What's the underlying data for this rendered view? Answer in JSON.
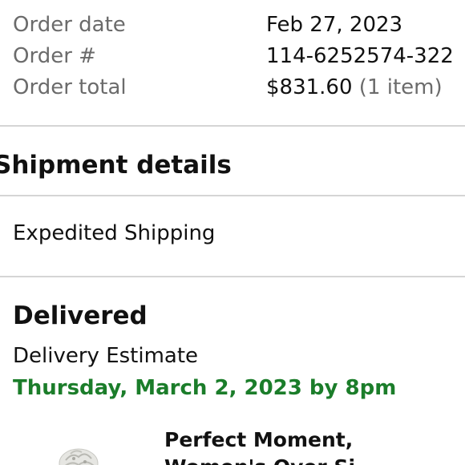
{
  "order_summary": {
    "date_label": "Order date",
    "date_value": "Feb 27, 2023",
    "number_label": "Order #",
    "number_value": "114-6252574-322",
    "total_label": "Order total",
    "total_value": "$831.60",
    "total_items": "(1 item)"
  },
  "shipment": {
    "section_title": "Shipment details",
    "shipping_speed": "Expedited Shipping",
    "status": "Delivered",
    "estimate_label": "Delivery Estimate",
    "estimate_date": "Thursday, March 2, 2023 by 8pm"
  },
  "product": {
    "title_line1": "Perfect Moment,",
    "title_line2": "Women's Over Si",
    "thumbnail_icon": "product-photo-icon"
  },
  "colors": {
    "label_gray": "#6b6b6b",
    "divider_gray": "#d5d5d5",
    "delivery_green": "#1b7d2a"
  }
}
